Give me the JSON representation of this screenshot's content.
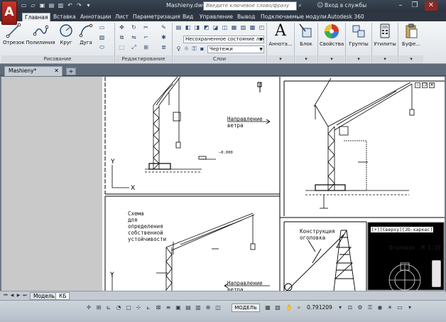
{
  "titlebar": {
    "document_name": "Mashieny.dwg",
    "search_placeholder": "Введите ключевое слово/фразу",
    "login_label": "Вход в службы",
    "qat_icons": [
      "new-icon",
      "open-icon",
      "save-icon",
      "saveas-icon",
      "print-icon",
      "undo-icon",
      "redo-icon",
      "dropdown-icon"
    ],
    "window_controls": [
      "minimize-icon",
      "restore-icon",
      "close-icon"
    ]
  },
  "ribbon_tabs": [
    "Главная",
    "Вставка",
    "Аннотации",
    "Лист",
    "Параметризация",
    "Вид",
    "Управление",
    "Вывод",
    "Подключаемые модули",
    "Autodesk 360"
  ],
  "ribbon": {
    "draw": {
      "title": "Рисование",
      "tools": [
        "Отрезок",
        "Полилиния",
        "Круг",
        "Дуга"
      ]
    },
    "modify": {
      "title": "Редактирование"
    },
    "layers": {
      "title": "Слои",
      "layer_state": "Несохраненное состояние листа",
      "current_layer": "Чертежи"
    },
    "annotation": {
      "label": "Аннота..."
    },
    "block": {
      "label": "Блок"
    },
    "properties": {
      "label": "Свойства"
    },
    "groups": {
      "label": "Группы"
    },
    "utilities": {
      "label": "Утилиты"
    },
    "clipboard": {
      "label": "Буфе..."
    }
  },
  "doc_tabs": {
    "active": "Mashieny*",
    "new_tab_icon": "plus-icon"
  },
  "drawing": {
    "wind_direction_1": "Направление\nветра",
    "wind_direction_2": "Направление\nветра",
    "scheme_label": "Схема\nдля\nопределения\nсобственной\nустойчивости",
    "tip_design": "Конструкция\nоголовка",
    "headpiece": "Оголовок  М 1:10",
    "viewport_label": "[+][Сверху][2D-каркас]"
  },
  "layout_tabs": [
    "Модель",
    "КБ"
  ],
  "statusbar": {
    "mode": "МОДЕЛЬ",
    "scale": "0.791209"
  }
}
